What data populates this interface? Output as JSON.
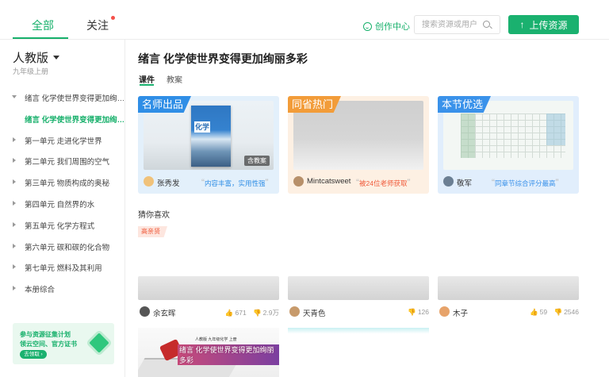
{
  "topbar": {
    "tabs": [
      "全部",
      "关注"
    ],
    "create_center": "创作中心",
    "search_placeholder": "搜索资源或用户",
    "upload_label": "上传资源",
    "brand_color": "#1ab16f"
  },
  "sidebar": {
    "edition": "人教版",
    "grade": "九年级上册",
    "items": [
      {
        "label": "绪言 化学使世界变得更加绚…"
      },
      {
        "label": "绪言 化学使世界变得更加绚…"
      },
      {
        "label": "第一单元 走进化学世界"
      },
      {
        "label": "第二单元 我们周围的空气"
      },
      {
        "label": "第三单元 物质构成的奥秘"
      },
      {
        "label": "第四单元 自然界的水"
      },
      {
        "label": "第五单元 化学方程式"
      },
      {
        "label": "第六单元 碳和碳的化合物"
      },
      {
        "label": "第七单元 燃料及其利用"
      },
      {
        "label": "本册综合"
      }
    ],
    "promo": {
      "line1": "参与资源征集计划",
      "line2": "领云空间、官方证书",
      "button": "去领取 ›"
    }
  },
  "main": {
    "title": "绪言 化学使世界变得更加绚丽多彩",
    "sub_tabs": [
      "课件",
      "教案"
    ],
    "featured": [
      {
        "badge": "名师出品",
        "author": "张秀发",
        "quote": "内容丰富，实用性强",
        "thumb_tag": "含教案",
        "cover_title": "化学",
        "badge_color": "#2f8ee6"
      },
      {
        "badge": "同省热门",
        "author": "Mintcatsweet",
        "quote": "被24位老师获取",
        "badge_color": "#f29c39"
      },
      {
        "badge": "本节优选",
        "author": "敬军",
        "quote": "同章节综合评分最高",
        "badge_color": "#3a92ea"
      }
    ],
    "guess_label": "猜你喜欢",
    "pill": "高亲贤",
    "recommendations": [
      {
        "author": "余玄晖",
        "likes": "671",
        "dislikes": "2.9万"
      },
      {
        "author": "天青色",
        "likes": "",
        "dislikes": "126"
      },
      {
        "author": "木子",
        "likes": "59",
        "dislikes": "2546"
      }
    ],
    "bottom_card": {
      "mini": "人教版 九年级化学 上册",
      "big": "绪言 化学使世界变得更加绚丽多彩"
    }
  }
}
